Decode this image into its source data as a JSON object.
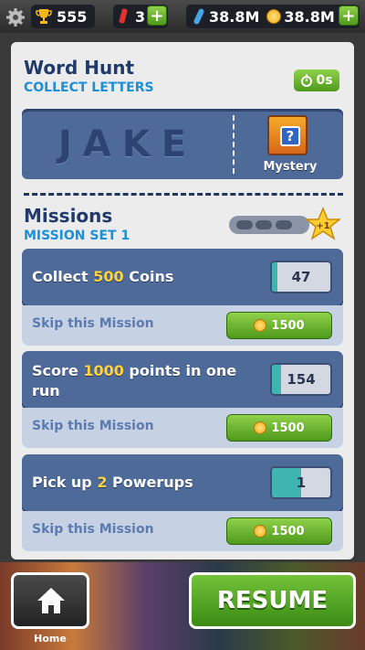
{
  "topbar": {
    "trophies": "555",
    "keys": "3",
    "boards": "38.8M",
    "coins": "38.8M",
    "plus": "+"
  },
  "word_hunt": {
    "title": "Word Hunt",
    "subtitle": "COLLECT LETTERS",
    "timer": "0s",
    "word": "JAKE",
    "reward_label": "Mystery",
    "reward_glyph": "?"
  },
  "missions": {
    "title": "Missions",
    "subtitle": "MISSION SET 1",
    "star_label": "+1",
    "progress_completed": 0,
    "progress_total": 3,
    "items": [
      {
        "pre": "Collect ",
        "highlight": "500",
        "post": " Coins",
        "counter": "47",
        "progress_fraction": 0.09,
        "skip_label": "Skip this Mission",
        "skip_cost": "1500"
      },
      {
        "pre": "Score ",
        "highlight": "1000",
        "post": " points in one run",
        "counter": "154",
        "progress_fraction": 0.15,
        "skip_label": "Skip this Mission",
        "skip_cost": "1500"
      },
      {
        "pre": "Pick up ",
        "highlight": "2",
        "post": " Powerups",
        "counter": "1",
        "progress_fraction": 0.5,
        "skip_label": "Skip this Mission",
        "skip_cost": "1500"
      }
    ]
  },
  "bottom": {
    "home_label": "Home",
    "resume_label": "RESUME"
  },
  "colors": {
    "card_blue": "#4d6a99",
    "highlight_yellow": "#ffd23e",
    "button_green": "#5aab24",
    "counter_fill": "#3fb5b1"
  }
}
